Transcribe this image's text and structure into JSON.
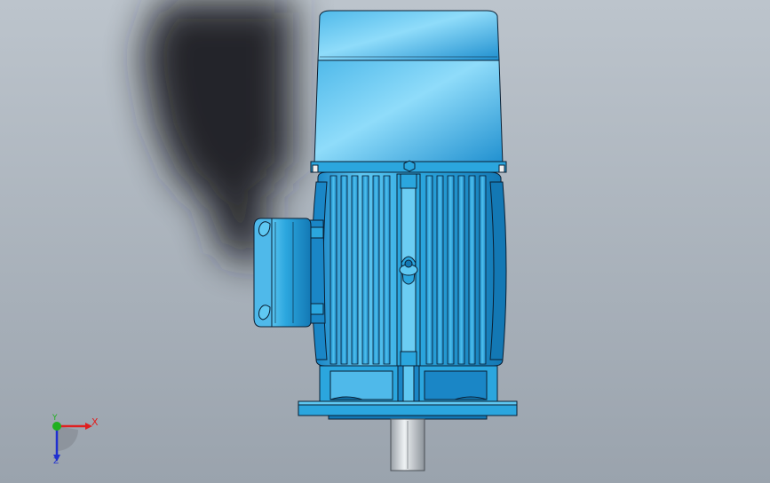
{
  "viewport": {
    "background_top": "#bcc4cc",
    "background_bottom": "#9aa3ad",
    "shadow_color": "#1a1c20"
  },
  "model": {
    "name": "motor",
    "body_color": "#2ba6de",
    "body_highlight": "#7fd6f7",
    "body_shade": "#1378b4",
    "outline_color": "#0a1f33",
    "shaft_color": "#c6ccd2"
  },
  "triad": {
    "x_label": "X",
    "y_label": "Y",
    "z_label": "Z",
    "x_color": "#e02020",
    "y_color": "#20b020",
    "z_color": "#2030d0"
  }
}
